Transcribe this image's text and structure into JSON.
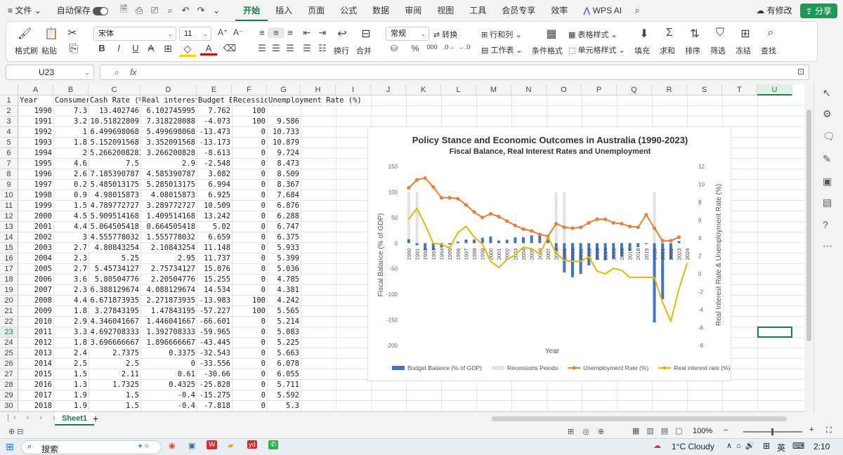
{
  "menubar": {
    "file": "文件",
    "autosave": "自动保存",
    "tabs": [
      "开始",
      "插入",
      "页面",
      "公式",
      "数据",
      "审阅",
      "视图",
      "工具",
      "会员专享",
      "效率"
    ],
    "active_tab": "开始",
    "wps_ai": "WPS AI",
    "modified": "有修改",
    "share": "分享"
  },
  "ribbon": {
    "format_painter": "格式刷",
    "paste": "粘贴",
    "font_name": "宋体",
    "font_size": "11",
    "wrap": "换行",
    "merge": "合并",
    "number_format": "常规",
    "convert": "转换",
    "row_col": "行和列",
    "worksheet": "工作表",
    "cond_format": "条件格式",
    "table_style": "表格样式",
    "cell_style": "单元格样式",
    "fill": "填充",
    "sum": "求和",
    "sort": "排序",
    "filter": "筛选",
    "freeze": "冻结",
    "find": "查找",
    "bold": "B",
    "italic": "I",
    "underline": "U",
    "strike": "A"
  },
  "formula_bar": {
    "name_box": "U23",
    "fx": "fx",
    "content": ""
  },
  "columns": [
    "A",
    "B",
    "C",
    "D",
    "E",
    "F",
    "G",
    "H",
    "I",
    "J",
    "K",
    "L",
    "M",
    "N",
    "O",
    "P",
    "Q",
    "R",
    "S",
    "T",
    "U"
  ],
  "rows": [
    [
      "Year",
      "Consumer",
      "Cash Rate (%)",
      "Real interest",
      "Budget Ba",
      "Recession",
      "Unemployment Rate (%)"
    ],
    [
      "1990",
      "7.3",
      "13.402746",
      "6.102745995",
      "7.762",
      "100",
      ""
    ],
    [
      "1991",
      "3.2",
      "10.51822809",
      "7.318228088",
      "-4.073",
      "100",
      "9.586"
    ],
    [
      "1992",
      "1",
      "6.499698068",
      "5.499698068",
      "-13.473",
      "0",
      "10.733"
    ],
    [
      "1993",
      "1.8",
      "5.152091568",
      "3.352091568",
      "-13.173",
      "0",
      "10.879"
    ],
    [
      "1994",
      "2",
      "5.26620082813",
      "3.266200828",
      "-8.613",
      "0",
      "9.724"
    ],
    [
      "1995",
      "4.6",
      "7.5",
      "2.9",
      "-2.548",
      "0",
      "8.473"
    ],
    [
      "1996",
      "2.6",
      "7.185390787",
      "4.585390787",
      "3.082",
      "0",
      "8.509"
    ],
    [
      "1997",
      "0.2",
      "5.485013175",
      "5.285013175",
      "6.994",
      "0",
      "8.367"
    ],
    [
      "1998",
      "0.9",
      "4.98015873",
      "4.08015873",
      "6.925",
      "0",
      "7.684"
    ],
    [
      "1999",
      "1.5",
      "4.789772727",
      "3.289772727",
      "10.509",
      "0",
      "6.876"
    ],
    [
      "2000",
      "4.5",
      "5.909514168",
      "1.409514168",
      "13.242",
      "0",
      "6.288"
    ],
    [
      "2001",
      "4.4",
      "5.064505418",
      "0.664505418",
      "5.02",
      "0",
      "6.747"
    ],
    [
      "2002",
      "3",
      "4.555778032",
      "1.555778032",
      "6.659",
      "0",
      "6.375"
    ],
    [
      "2003",
      "2.7",
      "4.80843254",
      "2.10843254",
      "11.148",
      "0",
      "5.933"
    ],
    [
      "2004",
      "2.3",
      "5.25",
      "2.95",
      "11.737",
      "0",
      "5.399"
    ],
    [
      "2005",
      "2.7",
      "5.45734127",
      "2.75734127",
      "15.076",
      "0",
      "5.036"
    ],
    [
      "2006",
      "3.6",
      "5.80504776",
      "2.20504776",
      "15.255",
      "0",
      "4.785"
    ],
    [
      "2007",
      "2.3",
      "6.388129674",
      "4.088129674",
      "14.534",
      "0",
      "4.381"
    ],
    [
      "2008",
      "4.4",
      "6.671873935",
      "2.271873935",
      "-13.983",
      "100",
      "4.242"
    ],
    [
      "2009",
      "1.8",
      "3.27843195",
      "1.47843195",
      "-57.227",
      "100",
      "5.565"
    ],
    [
      "2010",
      "2.9",
      "4.346041667",
      "1.446041667",
      "-66.601",
      "0",
      "5.214"
    ],
    [
      "2011",
      "3.3",
      "4.692708333",
      "1.392708333",
      "-59.965",
      "0",
      "5.083"
    ],
    [
      "2012",
      "1.8",
      "3.696666667",
      "1.896666667",
      "-43.445",
      "0",
      "5.225"
    ],
    [
      "2013",
      "2.4",
      "2.7375",
      "0.3375",
      "-32.543",
      "0",
      "5.663"
    ],
    [
      "2014",
      "2.5",
      "2.5",
      "0",
      "-33.556",
      "0",
      "6.078"
    ],
    [
      "2015",
      "1.5",
      "2.11",
      "0.61",
      "-30.66",
      "0",
      "6.055"
    ],
    [
      "2016",
      "1.3",
      "1.7325",
      "0.4325",
      "-25.828",
      "0",
      "5.711"
    ],
    [
      "2017",
      "1.9",
      "1.5",
      "-0.4",
      "-15.275",
      "0",
      "5.592"
    ],
    [
      "2018",
      "1.9",
      "1.5",
      "-0.4",
      "-7.818",
      "0",
      "5.3"
    ]
  ],
  "chart_data": {
    "type": "bar",
    "title": "Policy Stance and Economic Outcomes in Australia (1990-2023)",
    "subtitle": "Fiscal Balance, Real Interest Rates and Unemployment",
    "xlabel": "Year",
    "ylabel_left": "Fiscal Balance (% of GDP)",
    "ylabel_right": "Real Interest Rate  & Unemployment Rate (%)",
    "ylim_left": [
      -200,
      150
    ],
    "ylim_right": [
      -8,
      12
    ],
    "categories": [
      "1990",
      "1991",
      "1992",
      "1993",
      "1994",
      "1995",
      "1996",
      "1997",
      "1998",
      "1999",
      "2000",
      "2001",
      "2002",
      "2003",
      "2004",
      "2005",
      "2006",
      "2007",
      "2008",
      "2009",
      "2010",
      "2011",
      "2012",
      "2013",
      "2014",
      "2015",
      "2016",
      "2017",
      "2018",
      "2019",
      "2020",
      "2021",
      "2022",
      "2023",
      "2024"
    ],
    "left_ticks": [
      "150",
      "100",
      "50",
      "0",
      "-50",
      "-100",
      "-150",
      "-200"
    ],
    "right_ticks": [
      "12",
      "10",
      "8",
      "6",
      "4",
      "2",
      "0",
      "-2",
      "-4",
      "-6",
      "-8"
    ],
    "series": [
      {
        "name": "Budget Balance (% of GDP)",
        "kind": "bar",
        "axis": "left",
        "color": "#4472c4",
        "values": [
          7.762,
          -4.073,
          -13.473,
          -13.173,
          -8.613,
          -2.548,
          3.082,
          6.994,
          6.925,
          10.509,
          13.242,
          5.02,
          6.659,
          11.148,
          11.737,
          15.076,
          15.255,
          14.534,
          -13.983,
          -57.227,
          -66.601,
          -59.965,
          -43.445,
          -32.543,
          -33.556,
          -30.66,
          -25.828,
          -15.275,
          -7.818,
          -2,
          -155,
          -110,
          -32,
          4,
          null
        ]
      },
      {
        "name": "Recessions Peiods",
        "kind": "bar",
        "axis": "left",
        "color": "#e3e3e3",
        "values": [
          100,
          100,
          0,
          0,
          0,
          0,
          0,
          0,
          0,
          0,
          0,
          0,
          0,
          0,
          0,
          0,
          0,
          0,
          100,
          100,
          0,
          0,
          0,
          0,
          0,
          0,
          0,
          0,
          0,
          0,
          100,
          0,
          0,
          0,
          null
        ]
      },
      {
        "name": "Unemployment Rate (%)",
        "kind": "line",
        "axis": "right",
        "color": "#ed7d31",
        "values": [
          9.6,
          10.5,
          10.7,
          9.7,
          8.5,
          8.5,
          8.4,
          7.7,
          6.9,
          6.3,
          6.7,
          6.4,
          5.9,
          5.4,
          5.0,
          4.8,
          4.4,
          4.2,
          5.6,
          5.2,
          5.1,
          5.2,
          5.7,
          6.1,
          6.1,
          5.7,
          5.6,
          5.3,
          5.2,
          6.6,
          5.1,
          3.7,
          3.7,
          4.1,
          null
        ]
      },
      {
        "name": "Real interest rate (%)",
        "kind": "line",
        "axis": "right",
        "color": "#e6b800",
        "values": [
          6.1,
          7.3,
          5.5,
          3.4,
          3.3,
          2.9,
          4.6,
          5.3,
          4.1,
          3.3,
          1.4,
          0.7,
          1.6,
          2.1,
          3.0,
          2.8,
          2.2,
          4.1,
          2.3,
          1.5,
          1.4,
          1.4,
          1.9,
          0.3,
          0.0,
          0.6,
          0.4,
          -0.4,
          -0.4,
          -0.4,
          -0.4,
          -3.2,
          -5.3,
          -1.7,
          1.2
        ]
      }
    ]
  },
  "sheet": {
    "name": "Sheet1"
  },
  "status": {
    "zoom": "100%"
  },
  "taskbar": {
    "search": "搜索",
    "weather": "1°C  Cloudy",
    "ime": "英",
    "clock": "2:10"
  }
}
